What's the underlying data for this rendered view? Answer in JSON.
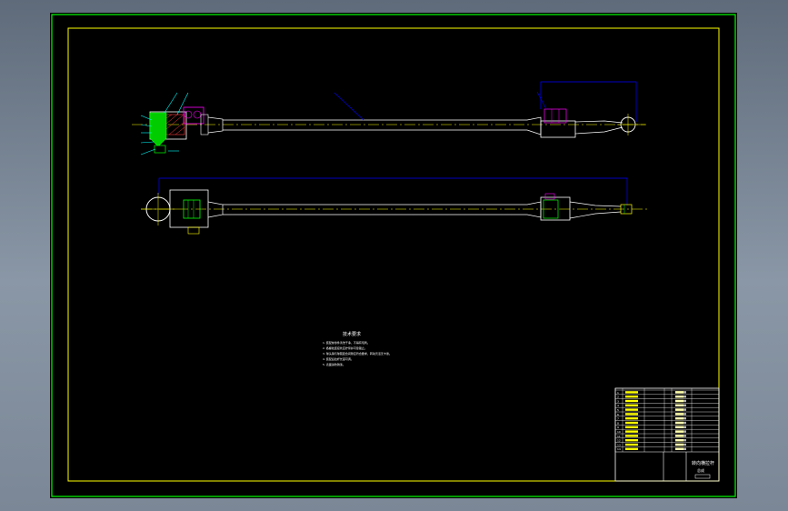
{
  "drawing": {
    "notes_title": "技术要求",
    "notes": [
      "1. 装配前零件清洗干净，不得有毛刺。",
      "2. 各螺纹连接处应拧紧并可靠锁止。",
      "3. 球头销与球碗配合间隙应符合要求，转动灵活无卡滞。",
      "4. 装配后拉杆长度可调。",
      "5. 表面涂防锈漆。"
    ],
    "title_block_name": "转向横拉杆",
    "title_block_sub": "总成",
    "part_numbers": [
      "1",
      "2",
      "3",
      "4",
      "5",
      "6",
      "7",
      "8",
      "9",
      "10",
      "11",
      "12",
      "13",
      "14"
    ],
    "header_labels": [
      "序号",
      "代号",
      "名称",
      "数量",
      "材料",
      "备注"
    ]
  },
  "colors": {
    "frame_outer": "#00ff00",
    "frame_inner": "#ffff00",
    "part_line": "#ffffff",
    "dimension": "#0000ff",
    "centerline": "#ffff00",
    "section_fill": "#00ff00",
    "thread": "#ff00ff",
    "leader": "#00ffff"
  }
}
